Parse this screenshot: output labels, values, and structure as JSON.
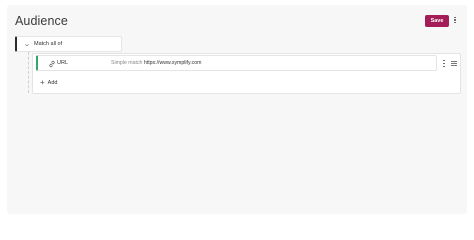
{
  "header": {
    "title": "Audience",
    "save_label": "Save"
  },
  "group": {
    "label": "Match all of"
  },
  "rule": {
    "type_label": "URL",
    "match_label": "Simple match",
    "match_value": "https://www.symplify.com"
  },
  "actions": {
    "add_label": "Add"
  },
  "colors": {
    "accent": "#a41d57",
    "rule_accent": "#2fa66a"
  },
  "icons": {
    "menu": "more-vertical-icon",
    "link": "link-icon",
    "drag": "drag-handle-icon",
    "chevron": "chevron-down-icon",
    "add": "plus-icon"
  }
}
